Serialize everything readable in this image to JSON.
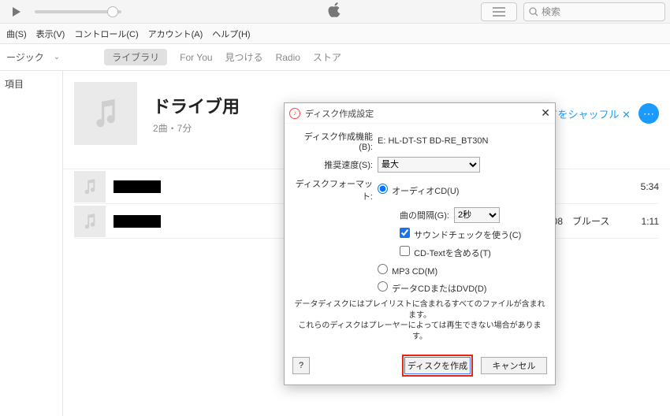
{
  "titlebar": {
    "search_placeholder": "検索"
  },
  "menu": {
    "s": "曲(S)",
    "v": "表示(V)",
    "c": "コントロール(C)",
    "a": "アカウント(A)",
    "h": "ヘルプ(H)"
  },
  "secbar": {
    "dd1": "ージック",
    "tab_lib": "ライブラリ",
    "tab_foryou": "For You",
    "tab_find": "見つける",
    "tab_radio": "Radio",
    "tab_store": "ストア"
  },
  "sidebar": {
    "item": "項目"
  },
  "playlist": {
    "title": "ドライブ用",
    "sub": "2曲・7分",
    "shuffle": "すべてをシャッフル",
    "dots": "⋯"
  },
  "tracks": [
    {
      "num": "",
      "genre": "",
      "dur": "5:34"
    },
    {
      "num": "08",
      "genre": "ブルース",
      "dur": "1:11"
    }
  ],
  "dialog": {
    "title": "ディスク作成設定",
    "drive_label": "ディスク作成機能(B):",
    "drive_value": "E: HL-DT-ST BD-RE_BT30N",
    "speed_label": "推奨速度(S):",
    "speed_value": "最大",
    "format_label": "ディスクフォーマット:",
    "opt_audio": "オーディオCD(U)",
    "gap_label": "曲の間隔(G):",
    "gap_value": "2秒",
    "soundcheck": "サウンドチェックを使う(C)",
    "cdtext": "CD-Textを含める(T)",
    "opt_mp3": "MP3 CD(M)",
    "opt_data": "データCDまたはDVD(D)",
    "note1": "データディスクにはプレイリストに含まれるすべてのファイルが含まれます。",
    "note2": "これらのディスクはプレーヤーによっては再生できない場合があります。",
    "help": "?",
    "ok": "ディスクを作成",
    "cancel": "キャンセル"
  }
}
